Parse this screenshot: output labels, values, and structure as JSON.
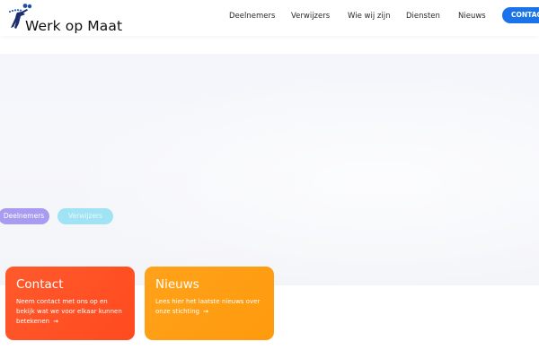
{
  "logo": {
    "text": "Werk op Maat",
    "icon": "logo-figure-icon"
  },
  "nav": {
    "items": [
      {
        "label": "Deelnemers"
      },
      {
        "label": "Verwijzers"
      },
      {
        "label": "Wie wij zijn"
      },
      {
        "label": "Diensten"
      },
      {
        "label": "Nieuws"
      }
    ],
    "cta_label": "CONTACT"
  },
  "hero": {
    "buttons": [
      {
        "label": "Deelnemers",
        "color": "#a99cf0"
      },
      {
        "label": "Verwijzers",
        "color": "#9fe3f5"
      }
    ]
  },
  "cards": {
    "contact": {
      "title": "Contact",
      "text": "Neem contact met ons op en bekijk wat we voor elkaar kunnen betekenen",
      "arrow_icon": "arrow-right-icon",
      "color": "#ff5a2c"
    },
    "news": {
      "title": "Nieuws",
      "text": "Lees hier het laatste nieuws over onze stichting",
      "arrow_icon": "arrow-right-icon",
      "color": "#ffa21a"
    }
  },
  "colors": {
    "accent": "#1a73e8"
  }
}
